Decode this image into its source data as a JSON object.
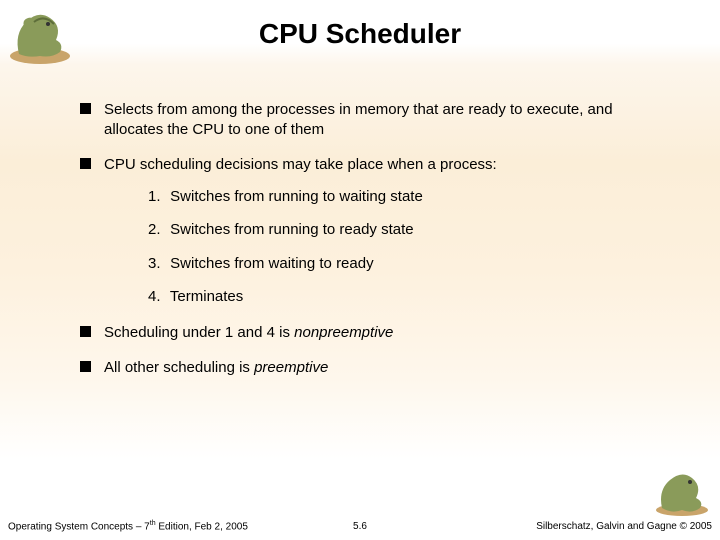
{
  "title": "CPU Scheduler",
  "bullets": {
    "b1": "Selects from among the processes in memory that are ready to execute, and allocates the CPU to one of them",
    "b2": "CPU scheduling decisions may take place when a process:",
    "b3_pre": "Scheduling under 1 and 4 is ",
    "b3_em": "nonpreemptive",
    "b4_pre": "All other scheduling is ",
    "b4_em": "preemptive"
  },
  "numbered": {
    "n1": "Switches from running to waiting state",
    "n2": "Switches from running to ready state",
    "n3": "Switches from waiting to ready",
    "n4": "Terminates"
  },
  "numbers": {
    "one": "1.",
    "two": "2.",
    "three": "3.",
    "four": "4."
  },
  "footer": {
    "left_pre": "Operating System Concepts – 7",
    "left_sup": "th",
    "left_post": " Edition, Feb 2, 2005",
    "center": "5.6",
    "right": "Silberschatz, Galvin and Gagne © 2005"
  }
}
